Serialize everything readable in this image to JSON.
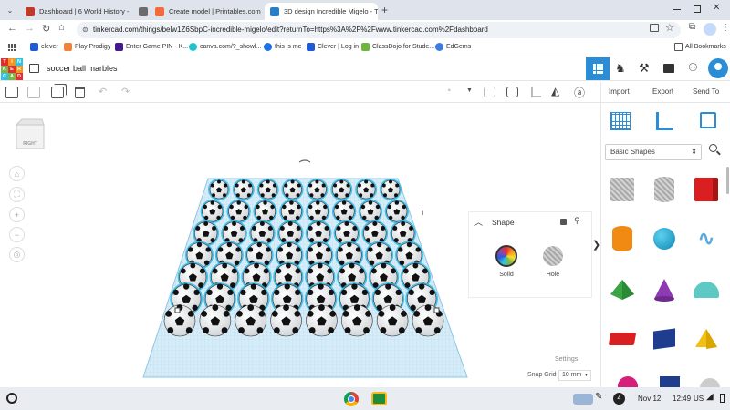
{
  "browser": {
    "tabs": [
      {
        "title": "Dashboard | 6 World History -",
        "favicon_color": "#c0392b",
        "active": false
      },
      {
        "title": "",
        "favicon_color": "#6b6b6b",
        "active": false
      },
      {
        "title": "Create model | Printables.com",
        "favicon_color": "#f26b3a",
        "active": false
      },
      {
        "title": "3D design Incredible Migelo - Ti",
        "favicon_color": "#2a7ec6",
        "active": true
      }
    ],
    "new_tab_label": "+",
    "url": "tinkercad.com/things/belw1Z6SbpC-incredible-migelo/edit?returnTo=https%3A%2F%2Fwww.tinkercad.com%2Fdashboard",
    "bookmarks": [
      {
        "label": "clever",
        "color": "#1f5bd6"
      },
      {
        "label": "Play Prodigy",
        "color": "#f0823b"
      },
      {
        "label": "Enter Game PIN - K...",
        "color": "#46178f"
      },
      {
        "label": "canva.com/?_showl...",
        "color": "#20c4cb"
      },
      {
        "label": "this is me",
        "color": "#1a73e8"
      },
      {
        "label": "Clever | Log in",
        "color": "#1f5bd6"
      },
      {
        "label": "ClassDojo for Stude...",
        "color": "#6cb63e"
      },
      {
        "label": "EdGems",
        "color": "#3c7be0"
      }
    ],
    "all_bookmarks": "All Bookmarks"
  },
  "app": {
    "logo_letters": [
      "T",
      "I",
      "N",
      "K",
      "E",
      "R",
      "C",
      "A",
      "D"
    ],
    "logo_colors": [
      "#e62d2d",
      "#f7941d",
      "#2ec4e6",
      "#7ab648",
      "#e62d2d",
      "#f7941d",
      "#2ec4e6",
      "#7ab648",
      "#e62d2d"
    ],
    "design_title": "soccer ball marbles",
    "accent": "#2a8dd6"
  },
  "toolbar_right": {
    "import": "Import",
    "export": "Export",
    "send_to": "Send To"
  },
  "viewcube": {
    "label": "RIGHT"
  },
  "shape_panel": {
    "title": "Shape",
    "solid_label": "Solid",
    "hole_label": "Hole"
  },
  "library": {
    "category": "Basic Shapes",
    "shapes": [
      "box-hole",
      "cylinder-hole",
      "box",
      "cylinder",
      "sphere",
      "scribble",
      "roof",
      "cone",
      "round-roof",
      "text",
      "shape-generator",
      "pyramid"
    ]
  },
  "workplane": {
    "settings_label": "Settings",
    "snap_grid_label": "Snap Grid",
    "snap_grid_value": "10 mm",
    "ball_rows": 7,
    "balls_per_row": 8
  },
  "taskbar": {
    "date": "Nov 12",
    "time": "12:49",
    "locale": "US",
    "notifications": "4"
  }
}
